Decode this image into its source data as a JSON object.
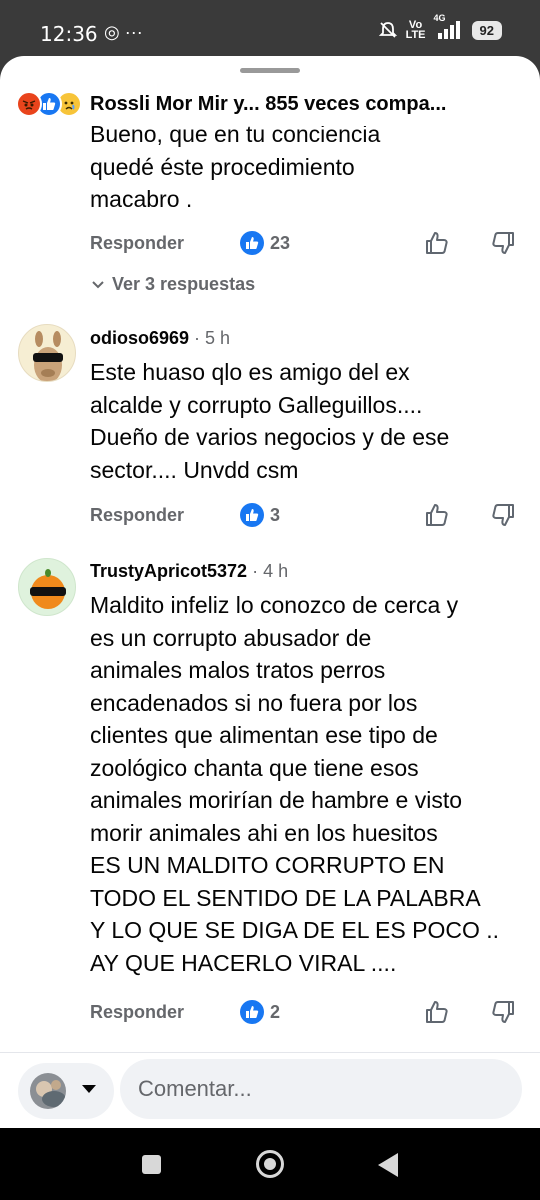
{
  "status_bar": {
    "time": "12:36",
    "left_icons": "◎ ···",
    "network_top": "Vo",
    "network_bottom": "LTE",
    "signal_label": "4G",
    "battery": "92"
  },
  "header": {
    "title": "Rossli Mor Mir y...  855 veces compa..."
  },
  "comments": [
    {
      "text_lines": [
        "Bueno,  que  en tu  conciencia",
        "quedé  éste  procedimiento",
        "macabro ."
      ],
      "reply_label": "Responder",
      "likes": "23",
      "view_replies": "Ver 3 respuestas"
    },
    {
      "author": "odioso6969",
      "time": "5 h",
      "text_lines": [
        "Este huaso qlo es amigo del ex",
        "alcalde y corrupto Galleguillos....",
        "Dueño de varios negocios y de ese",
        "sector.... Unvdd csm"
      ],
      "reply_label": "Responder",
      "likes": "3"
    },
    {
      "author": "TrustyApricot5372",
      "time": "4 h",
      "text_lines": [
        "Maldito infeliz lo conozco de cerca y",
        "es un corrupto abusador de",
        "animales malos tratos perros",
        "encadenados si no fuera por los",
        "clientes que alimentan ese tipo de",
        "zoológico chanta que tiene esos",
        "animales morirían de hambre e visto",
        "morir animales ahi en los huesitos",
        "ES UN MALDITO CORRUPTO  EN",
        "TODO EL SENTIDO DE LA PALABRA",
        "Y LO QUE SE DIGA DE EL ES POCO ..",
        "AY QUE HACERLO VIRAL ...."
      ],
      "reply_label": "Responder",
      "likes": "2"
    }
  ],
  "composer": {
    "placeholder": "Comentar..."
  },
  "colors": {
    "facebook_blue": "#1877f2",
    "secondary_text": "#65676b",
    "angry": "#e9441c",
    "sad": "#f7c439"
  },
  "icons": [
    "angry-reaction-icon",
    "like-reaction-icon",
    "sad-reaction-icon",
    "thumb-up-icon",
    "thumb-down-icon",
    "chevron-down-icon",
    "square-nav-icon",
    "home-nav-icon",
    "back-nav-icon"
  ]
}
